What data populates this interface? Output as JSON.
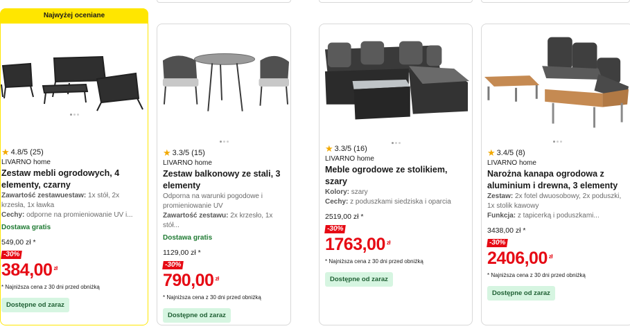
{
  "colors": {
    "badge": "#ffe600",
    "discount": "#e60a14",
    "shipping": "#1e7a32",
    "availability_bg": "#d6f5e1",
    "star": "#f2a900"
  },
  "products": [
    {
      "badge": "Najwyżej oceniane",
      "rating": "4.8/5 (25)",
      "brand": "LIVARNO home",
      "title": "Zestaw mebli ogrodowych, 4 elementy, czarny",
      "attrs": [
        {
          "label": "Zawartość zestawuestaw:",
          "value": " 1x stół, 2x krzesła, 1x ławka"
        },
        {
          "label": "Cechy:",
          "value": " odporne na promieniowanie UV i..."
        }
      ],
      "shipping": "Dostawa gratis",
      "old_price": "549,00 zł *",
      "discount": "-30%",
      "price": "384,00",
      "currency": "zł",
      "note": "* Najniższa cena z 30 dni przed obniżką",
      "availability": "Dostępne od zaraz"
    },
    {
      "rating": "3.3/5 (15)",
      "brand": "LIVARNO home",
      "title": "Zestaw balkonowy ze stali, 3 elementy",
      "description": "Odporna na warunki pogodowe i promieniowanie UV",
      "attrs": [
        {
          "label": "Zawartość zestawu:",
          "value": " 2x krzesło, 1x stół..."
        }
      ],
      "shipping": "Dostawa gratis",
      "old_price": "1129,00 zł *",
      "discount": "-30%",
      "price": "790,00",
      "currency": "zł",
      "note": "* Najniższa cena z 30 dni przed obniżką",
      "availability": "Dostępne od zaraz"
    },
    {
      "rating": "3.3/5 (16)",
      "brand": "LIVARNO home",
      "title": "Meble ogrodowe ze stolikiem, szary",
      "attrs": [
        {
          "label": "Kolory:",
          "value": " szary"
        },
        {
          "label": "Cechy:",
          "value": " z poduszkami siedziska i oparcia"
        }
      ],
      "old_price": "2519,00 zł *",
      "discount": "-30%",
      "price": "1763,00",
      "currency": "zł",
      "note": "* Najniższa cena z 30 dni przed obniżką",
      "availability": "Dostępne od zaraz"
    },
    {
      "rating": "3.4/5 (8)",
      "brand": "LIVARNO home",
      "title": "Narożna kanapa ogrodowa z aluminium i drewna, 3 elementy",
      "attrs": [
        {
          "label": "Zestaw:",
          "value": " 2x fotel dwuosobowy, 2x poduszki, 1x stolik kawowy"
        },
        {
          "label": "Funkcja:",
          "value": " z tapicerką i poduszkami..."
        }
      ],
      "old_price": "3438,00 zł *",
      "discount": "-30%",
      "price": "2406,00",
      "currency": "zł",
      "note": "* Najniższa cena z 30 dni przed obniżką",
      "availability": "Dostępne od zaraz"
    }
  ]
}
